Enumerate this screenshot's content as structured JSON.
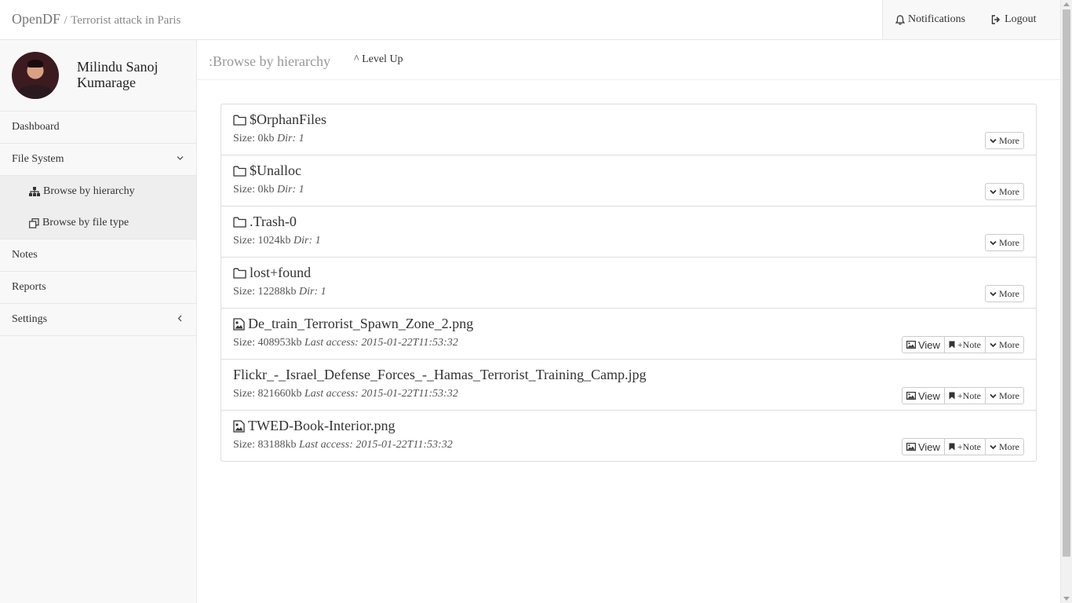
{
  "header": {
    "brand": "OpenDF",
    "separator": "/",
    "case_title": "Terrorist attack in Paris",
    "notifications_label": "Notifications",
    "logout_label": "Logout"
  },
  "user": {
    "name": "Milindu Sanoj Kumarage"
  },
  "sidebar": {
    "items": [
      {
        "label": "Dashboard"
      },
      {
        "label": "File System"
      },
      {
        "label": "Notes"
      },
      {
        "label": "Reports"
      },
      {
        "label": "Settings"
      }
    ],
    "file_system_sub": [
      {
        "label": "Browse by hierarchy"
      },
      {
        "label": "Browse by file type"
      }
    ]
  },
  "main": {
    "title": ":Browse by hierarchy",
    "level_up": "^ Level Up"
  },
  "buttons": {
    "view": "View",
    "note": "+Note",
    "more": "More"
  },
  "files": [
    {
      "name": "$OrphanFiles",
      "icon": "folder-icon",
      "size": "Size: 0kb",
      "extra": "Dir: 1"
    },
    {
      "name": "$Unalloc",
      "icon": "folder-icon",
      "size": "Size: 0kb",
      "extra": "Dir: 1"
    },
    {
      "name": ".Trash-0",
      "icon": "folder-icon",
      "size": "Size: 1024kb",
      "extra": "Dir: 1"
    },
    {
      "name": "lost+found",
      "icon": "folder-icon",
      "size": "Size: 12288kb",
      "extra": "Dir: 1"
    },
    {
      "name": "De_train_Terrorist_Spawn_Zone_2.png",
      "icon": "image-icon",
      "size": "Size: 408953kb",
      "extra": "Last access: 2015-01-22T11:53:32"
    },
    {
      "name": "Flickr_-_Israel_Defense_Forces_-_Hamas_Terrorist_Training_Camp.jpg",
      "icon": "",
      "size": "Size: 821660kb",
      "extra": "Last access: 2015-01-22T11:53:32"
    },
    {
      "name": "TWED-Book-Interior.png",
      "icon": "image-icon",
      "size": "Size: 83188kb",
      "extra": "Last access: 2015-01-22T11:53:32"
    }
  ]
}
